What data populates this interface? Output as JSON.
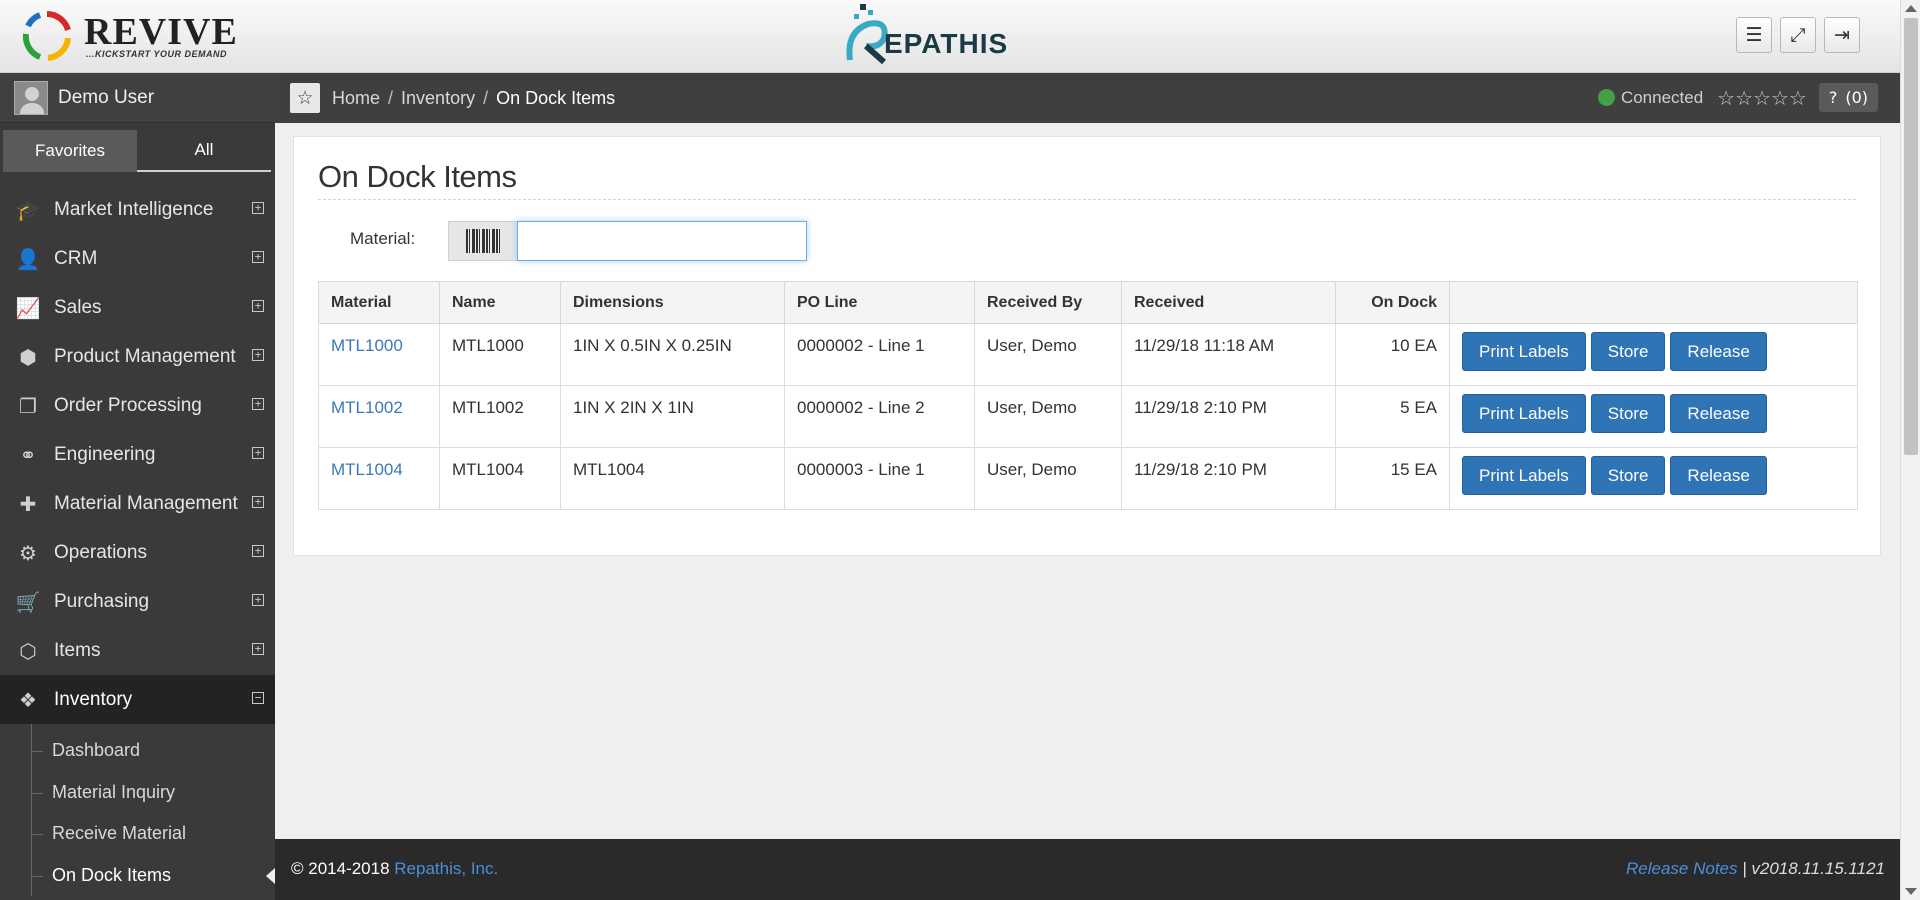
{
  "header": {
    "revive_logo_text": "REVIVE",
    "revive_tagline": "...KICKSTART YOUR DEMAND",
    "repathis_logo_text": "EPATHIS",
    "buttons": {
      "menu_icon": "hamburger-menu-icon",
      "fullscreen_icon": "expand-icon",
      "logout_icon": "sign-out-icon"
    }
  },
  "sidebar": {
    "user_name": "Demo User",
    "tabs": [
      "Favorites",
      "All"
    ],
    "items": [
      {
        "label": "Market Intelligence",
        "icon": "graduation-cap-icon"
      },
      {
        "label": "CRM",
        "icon": "user-icon"
      },
      {
        "label": "Sales",
        "icon": "line-chart-icon"
      },
      {
        "label": "Product Management",
        "icon": "cube-icon"
      },
      {
        "label": "Order Processing",
        "icon": "copy-icon"
      },
      {
        "label": "Engineering",
        "icon": "link-icon"
      },
      {
        "label": "Material Management",
        "icon": "puzzle-icon"
      },
      {
        "label": "Operations",
        "icon": "cogs-icon"
      },
      {
        "label": "Purchasing",
        "icon": "shopping-cart-icon"
      },
      {
        "label": "Items",
        "icon": "cubes-icon"
      },
      {
        "label": "Inventory",
        "icon": "boxes-icon"
      }
    ],
    "sub_items": [
      "Dashboard",
      "Material Inquiry",
      "Receive Material",
      "On Dock Items"
    ]
  },
  "breadcrumb": {
    "home": "Home",
    "section": "Inventory",
    "current": "On Dock Items",
    "sep": "/",
    "status": "Connected",
    "stars": "☆☆☆☆☆",
    "help_label": "?",
    "help_count": "(0)"
  },
  "page": {
    "title": "On Dock Items",
    "filter_label": "Material:",
    "filter_value": ""
  },
  "table": {
    "headers": [
      "Material",
      "Name",
      "Dimensions",
      "PO Line",
      "Received By",
      "Received",
      "On Dock",
      ""
    ],
    "rows": [
      {
        "material": "MTL1000",
        "name": "MTL1000",
        "dimensions": "1IN X 0.5IN X 0.25IN",
        "po_line": "0000002 - Line 1",
        "received_by": "User, Demo",
        "received": "11/29/18 11:18 AM",
        "on_dock": "10 EA"
      },
      {
        "material": "MTL1002",
        "name": "MTL1002",
        "dimensions": "1IN X 2IN X 1IN",
        "po_line": "0000002 - Line 2",
        "received_by": "User, Demo",
        "received": "11/29/18 2:10 PM",
        "on_dock": "5 EA"
      },
      {
        "material": "MTL1004",
        "name": "MTL1004",
        "dimensions": "MTL1004",
        "po_line": "0000003 - Line 1",
        "received_by": "User, Demo",
        "received": "11/29/18 2:10 PM",
        "on_dock": "15 EA"
      }
    ],
    "actions": {
      "print": "Print Labels",
      "store": "Store",
      "release": "Release"
    }
  },
  "footer": {
    "copyright": "© 2014-2018",
    "company": "Repathis, Inc.",
    "release_notes": "Release Notes",
    "version": "| v2018.11.15.1121"
  },
  "colors": {
    "accent": "#2f74b5",
    "link": "#3c78b4",
    "connected": "#43a047",
    "sidebar": "#3a3a3a"
  }
}
